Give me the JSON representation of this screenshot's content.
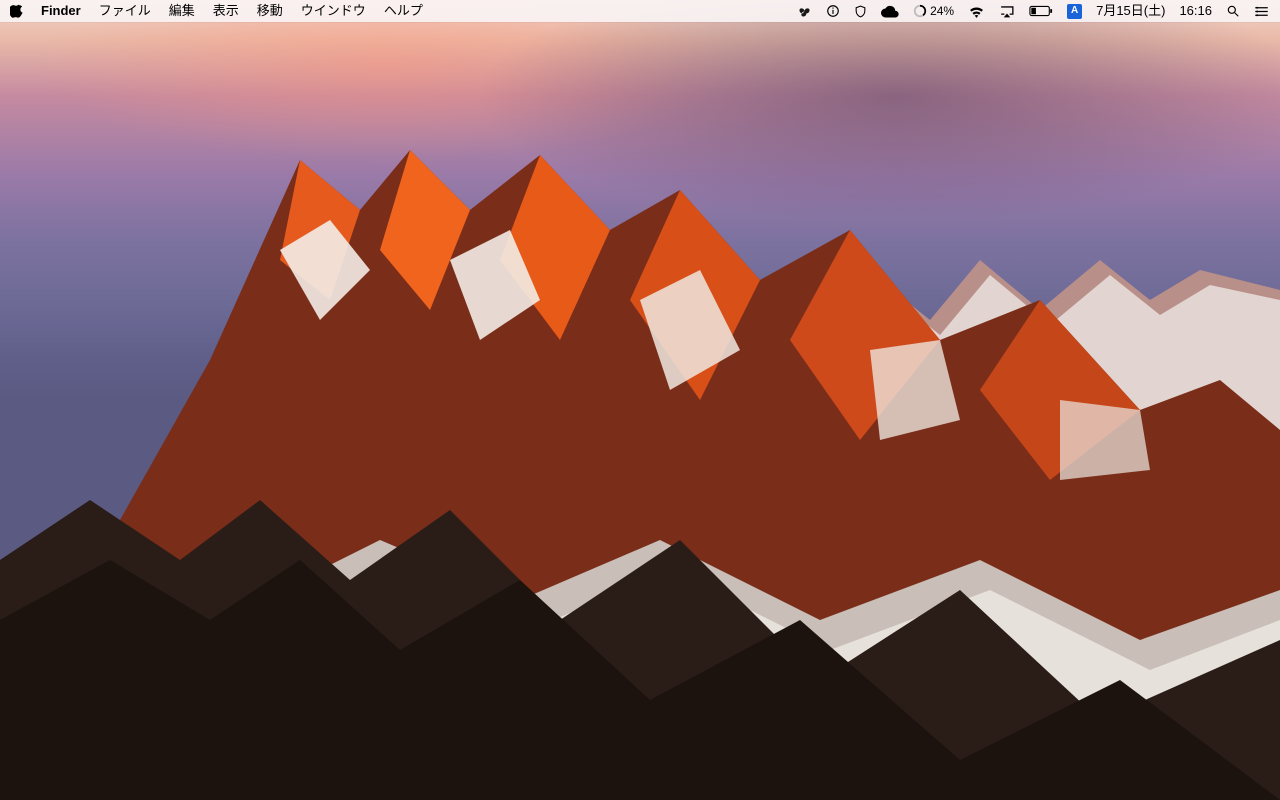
{
  "menubar": {
    "app_name": "Finder",
    "menus": [
      "ファイル",
      "編集",
      "表示",
      "移動",
      "ウインドウ",
      "ヘルプ"
    ]
  },
  "status": {
    "battery_percent": "24%",
    "ime_label": "A",
    "date": "7月15日(土)",
    "time": "16:16"
  },
  "icons": {
    "apple": "apple-logo-icon",
    "fan": "fan-control-icon",
    "info": "info-icon",
    "shield": "shield-icon",
    "cloud": "cloud-icon",
    "battery_ring": "battery-ring-icon",
    "wifi": "wifi-icon",
    "airplay": "airplay-icon",
    "battery": "battery-icon",
    "ime": "ime-icon",
    "spotlight": "spotlight-search-icon",
    "notifications": "notification-center-icon"
  }
}
